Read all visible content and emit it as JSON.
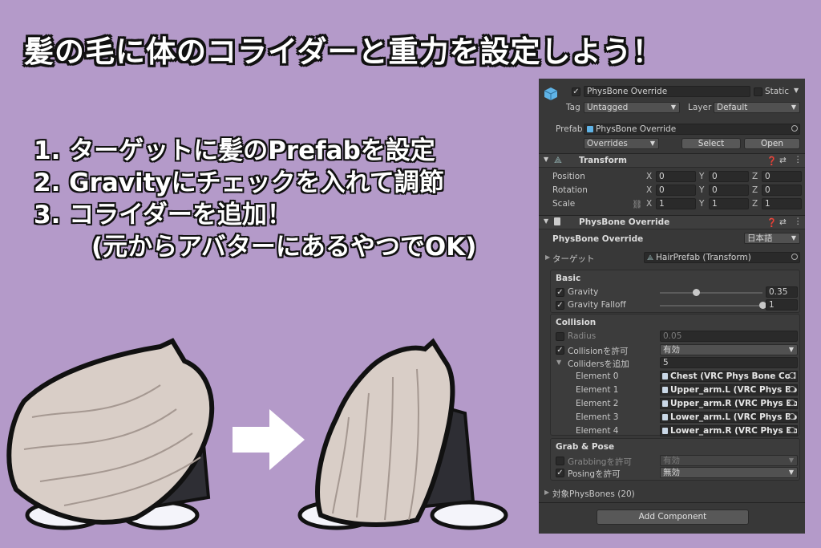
{
  "headline": "髪の毛に体のコライダーと重力を設定しよう！",
  "steps": {
    "line1": "1. ターゲットに髪のPrefabを設定",
    "line2": "2. Gravityにチェックを入れて調節",
    "line3": "3. コライダーを追加！",
    "line4": "(元からアバターにあるやつでOK)"
  },
  "inspector": {
    "object_name": "PhysBone Override",
    "static_label": "Static",
    "tag_label": "Tag",
    "tag_value": "Untagged",
    "layer_label": "Layer",
    "layer_value": "Default",
    "prefab_label": "Prefab",
    "prefab_value": "PhysBone Override",
    "overrides_label": "Overrides",
    "select_label": "Select",
    "open_label": "Open",
    "transform": {
      "title": "Transform",
      "position_label": "Position",
      "rotation_label": "Rotation",
      "scale_label": "Scale",
      "position": [
        "0",
        "0",
        "0"
      ],
      "rotation": [
        "0",
        "0",
        "0"
      ],
      "scale": [
        "1",
        "1",
        "1"
      ],
      "axis": [
        "X",
        "Y",
        "Z"
      ]
    },
    "physbone": {
      "title": "PhysBone Override",
      "name_label": "PhysBone Override",
      "language": "日本語",
      "target_label": "ターゲット",
      "target_value": "HairPrefab (Transform)",
      "basic_label": "Basic",
      "gravity_label": "Gravity",
      "gravity_value": "0.35",
      "gravity_level": 0.35,
      "gravity_falloff_label": "Gravity Falloff",
      "gravity_falloff_value": "1",
      "gravity_falloff_level": 1.0,
      "collision_label": "Collision",
      "radius_label": "Radius",
      "radius_value": "0.05",
      "allow_collision_label": "Collisionを許可",
      "allow_collision_value": "有効",
      "colliders_label": "Collidersを追加",
      "colliders_count": "5",
      "elements": [
        {
          "label": "Element 0",
          "value": "Chest (VRC Phys Bone Collider)"
        },
        {
          "label": "Element 1",
          "value": "Upper_arm.L (VRC Phys Bone Collider)"
        },
        {
          "label": "Element 2",
          "value": "Upper_arm.R (VRC Phys Bone Collider)"
        },
        {
          "label": "Element 3",
          "value": "Lower_arm.L (VRC Phys Bone Collider)"
        },
        {
          "label": "Element 4",
          "value": "Lower_arm.R (VRC Phys Bone Collider)"
        }
      ],
      "grab_pose_label": "Grab & Pose",
      "grabbing_label": "Grabbingを許可",
      "grabbing_value": "有効",
      "posing_label": "Posingを許可",
      "posing_value": "無効",
      "targets_label": "対象PhysBones (20)"
    },
    "add_component_label": "Add Component"
  },
  "colors": {
    "background": "#b49ac9",
    "panel": "#383838",
    "hair": "#d9cec7",
    "outline": "#111111"
  }
}
